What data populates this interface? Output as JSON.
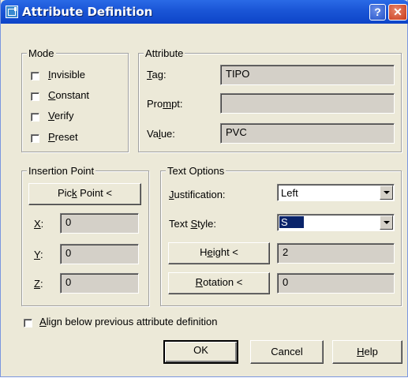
{
  "window": {
    "title": "Attribute Definition",
    "help_glyph": "?",
    "close_glyph": "✕"
  },
  "mode": {
    "legend": "Mode",
    "items": [
      {
        "pre": "",
        "acc": "I",
        "post": "nvisible",
        "checked": false
      },
      {
        "pre": "",
        "acc": "C",
        "post": "onstant",
        "checked": false
      },
      {
        "pre": "",
        "acc": "V",
        "post": "erify",
        "checked": false
      },
      {
        "pre": "",
        "acc": "P",
        "post": "reset",
        "checked": false
      }
    ]
  },
  "attribute": {
    "legend": "Attribute",
    "tag_label": {
      "pre": "",
      "acc": "T",
      "post": "ag:"
    },
    "tag_value": "TIPO",
    "prompt_label": {
      "pre": "Pro",
      "acc": "m",
      "post": "pt:"
    },
    "prompt_value": "",
    "value_label": {
      "pre": "Va",
      "acc": "l",
      "post": "ue:"
    },
    "value_value": "PVC"
  },
  "insertion": {
    "legend": "Insertion Point",
    "pick_button": {
      "pre": "Pic",
      "acc": "k",
      "post": " Point <"
    },
    "x_label": {
      "acc": "X",
      "post": ":"
    },
    "x_value": "0",
    "y_label": {
      "acc": "Y",
      "post": ":"
    },
    "y_value": "0",
    "z_label": {
      "acc": "Z",
      "post": ":"
    },
    "z_value": "0"
  },
  "text_options": {
    "legend": "Text Options",
    "justification_label": {
      "pre": "",
      "acc": "J",
      "post": "ustification:"
    },
    "justification_value": "Left",
    "style_label": {
      "pre": "Text ",
      "acc": "S",
      "post": "tyle:"
    },
    "style_value": "S",
    "height_button": {
      "pre": "H",
      "acc": "e",
      "post": "ight <"
    },
    "height_value": "2",
    "rotation_button": {
      "pre": "",
      "acc": "R",
      "post": "otation <"
    },
    "rotation_value": "0"
  },
  "align": {
    "pre": "",
    "acc": "A",
    "post": "lign below previous attribute definition",
    "checked": false
  },
  "buttons": {
    "ok": "OK",
    "cancel": "Cancel",
    "help": {
      "pre": "",
      "acc": "H",
      "post": "elp"
    }
  }
}
